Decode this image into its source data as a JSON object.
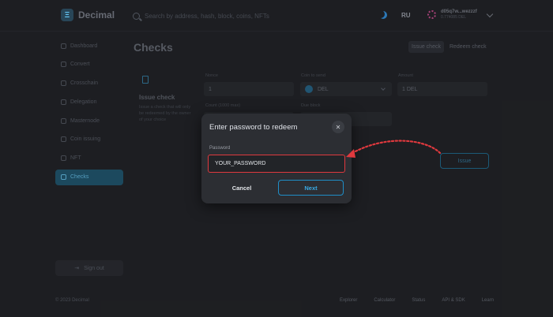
{
  "header": {
    "logo_text": "Decimal",
    "search_placeholder": "Search by address, hash, block, coins, NFTs",
    "language": "RU",
    "account_address": "d05q7w...wezzzf",
    "account_balance": "0.774085 DEL"
  },
  "sidebar": {
    "items": [
      {
        "label": "Dashboard",
        "icon": "dashboard-icon"
      },
      {
        "label": "Convert",
        "icon": "convert-icon"
      },
      {
        "label": "Crosschain",
        "icon": "crosschain-icon"
      },
      {
        "label": "Delegation",
        "icon": "delegation-icon"
      },
      {
        "label": "Masternode",
        "icon": "masternode-icon"
      },
      {
        "label": "Coin issuing",
        "icon": "coin-icon"
      },
      {
        "label": "NFT",
        "icon": "nft-icon"
      },
      {
        "label": "Checks",
        "icon": "check-icon",
        "active": true
      }
    ],
    "sign_out": "Sign out"
  },
  "main": {
    "title": "Checks",
    "tabs": [
      "Issue check",
      "Redeem check"
    ],
    "card_title": "Issue check",
    "card_desc": "Issue a check that will only be redeemed by the owner of your choice",
    "fields": {
      "nonce_label": "Nonce",
      "nonce_value": "1",
      "coin_label": "Coin to send",
      "coin_value": "DEL",
      "amount_label": "Amount",
      "amount_value": "1 DEL",
      "count_label": "Count (1000 max)",
      "due_label": "Due block"
    },
    "issue_button": "Issue"
  },
  "modal": {
    "title": "Enter password to redeem",
    "password_label": "Password",
    "password_value": "YOUR_PASSWORD",
    "cancel_label": "Cancel",
    "next_label": "Next"
  },
  "footer": {
    "copyright": "© 2023 Decimal",
    "links": [
      "Explorer",
      "Calculator",
      "Status",
      "API & SDK",
      "Learn"
    ]
  },
  "colors": {
    "accent": "#1f8ec7",
    "highlight_border": "#e0393e",
    "annotation_arrow": "#e0393e"
  }
}
